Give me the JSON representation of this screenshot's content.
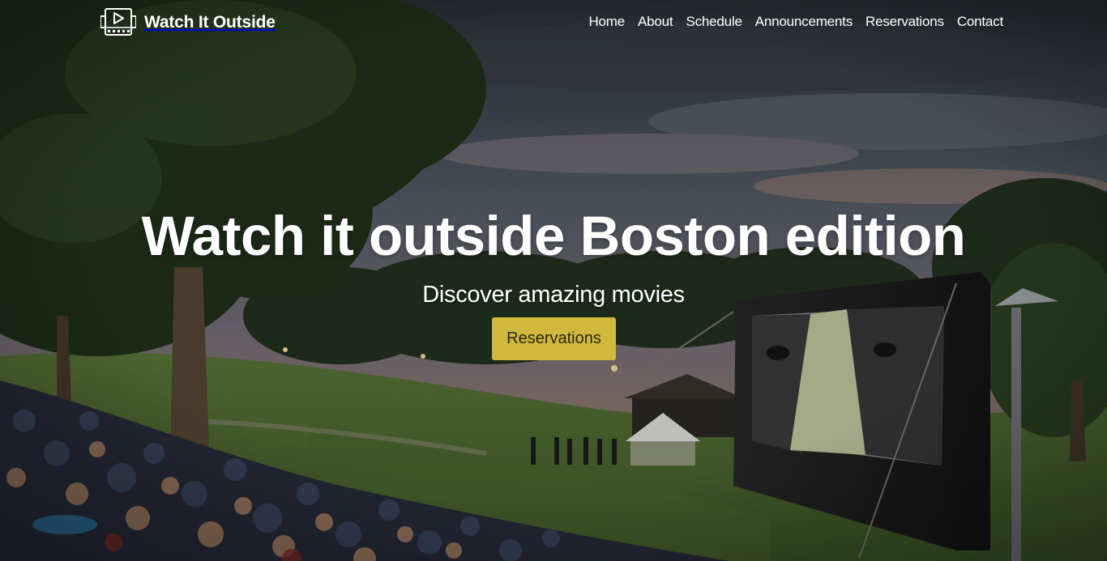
{
  "brand": {
    "name": "Watch It Outside",
    "icon": "film-play-icon"
  },
  "nav": {
    "items": [
      {
        "label": "Home"
      },
      {
        "label": "About"
      },
      {
        "label": "Schedule"
      },
      {
        "label": "Announcements"
      },
      {
        "label": "Reservations"
      },
      {
        "label": "Contact"
      }
    ]
  },
  "hero": {
    "title": "Watch it outside Boston edition",
    "subtitle": "Discover amazing movies",
    "cta_label": "Reservations"
  },
  "colors": {
    "cta_background": "#d0b83c",
    "cta_text": "#2b2610",
    "text": "#ffffff"
  }
}
